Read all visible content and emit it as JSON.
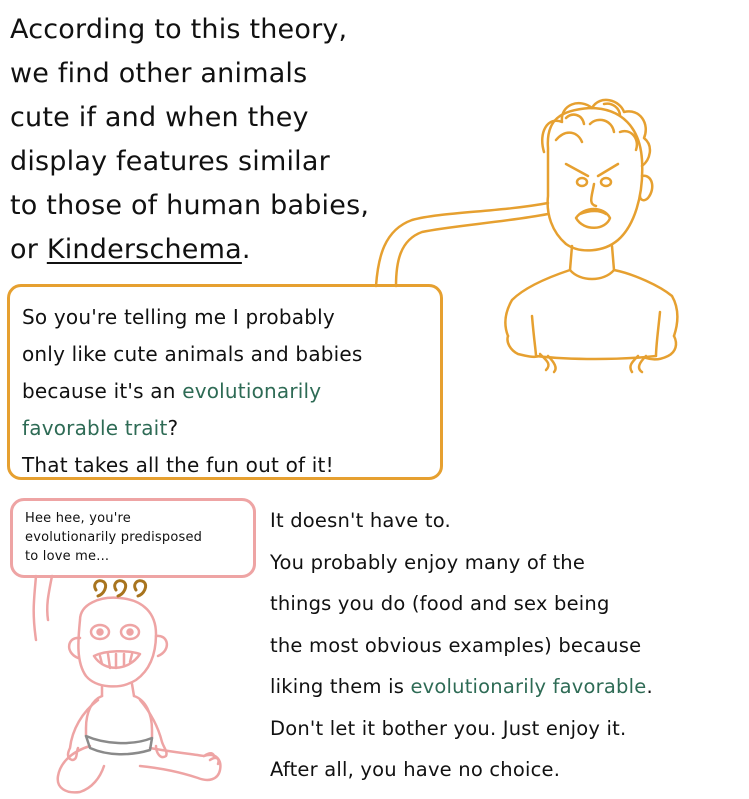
{
  "colors": {
    "ink": "#111111",
    "guy_line": "#e6a030",
    "baby_line": "#eea4a4",
    "emphasis_green": "#2e6b55",
    "baby_hair": "#a8741e",
    "diaper_line": "#8a8a8a"
  },
  "narration": {
    "line1": "According to this theory,",
    "line2": "we find other animals",
    "line3": "cute if and when they",
    "line4": "display features similar",
    "line5": "to those of human babies,",
    "line6_prefix": "or ",
    "line6_term": "Kinderschema",
    "line6_suffix": "."
  },
  "guy_speech": {
    "line1": "So you're telling me I probably",
    "line2": "only like cute animals and babies",
    "line3": "because it's an ",
    "line3_green": "evolutionarily",
    "line4_green": "favorable trait",
    "line4_suffix": "?",
    "line5": "That takes all the fun out of it!"
  },
  "baby_speech": {
    "line1": "Hee hee, you're",
    "line2": "evolutionarily predisposed",
    "line3": "to love me..."
  },
  "reply": {
    "line1": "It doesn't have to.",
    "line2": "You probably enjoy many of the",
    "line3": "things you do (food and sex being",
    "line4": "the most obvious examples) because",
    "line5_prefix": "liking them is ",
    "line5_green": "evolutionarily favorable",
    "line5_suffix": ".",
    "line6": "Don't let it bother you. Just enjoy it.",
    "line7": "After all, you have no choice."
  }
}
